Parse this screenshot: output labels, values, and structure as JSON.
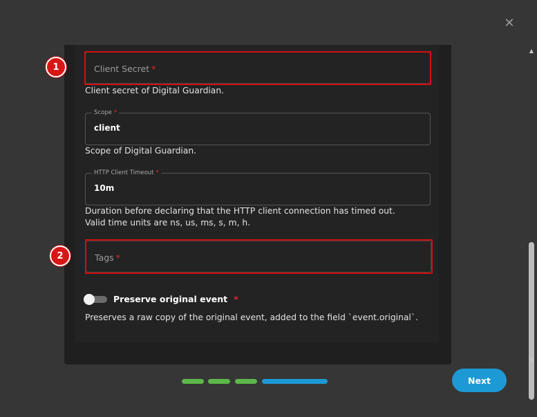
{
  "modal": {
    "close_glyph": "✕"
  },
  "fields": {
    "client_secret": {
      "placeholder": "Client Secret",
      "required_mark": "*",
      "help": "Client secret of Digital Guardian."
    },
    "scope": {
      "label": "Scope",
      "required_mark": "*",
      "value": "client",
      "help": "Scope of Digital Guardian."
    },
    "http_timeout": {
      "label": "HTTP Client Timeout",
      "required_mark": "*",
      "value": "10m",
      "help_line1": "Duration before declaring that the HTTP client connection has timed out.",
      "help_line2": "Valid time units are ns, us, ms, s, m, h."
    },
    "tags": {
      "placeholder": "Tags",
      "required_mark": "*"
    },
    "preserve_original": {
      "label": "Preserve original event",
      "required_mark": "*",
      "enabled": false,
      "help": "Preserves a raw copy of the original event, added to the field `event.original`."
    }
  },
  "annotations": {
    "badge1": "1",
    "badge2": "2",
    "highlight_color": "#d40f0f"
  },
  "stepper": {
    "total_steps": 4,
    "current_step": 4,
    "completed_color": "#5db84a",
    "active_color": "#1c9ad6"
  },
  "footer": {
    "next_label": "Next"
  },
  "scrollbar": {
    "up_glyph": "▲",
    "down_glyph": "▼"
  }
}
